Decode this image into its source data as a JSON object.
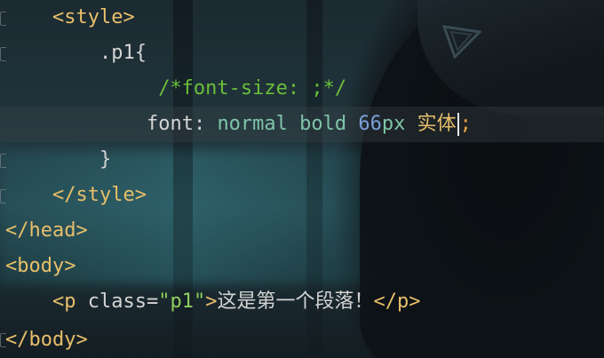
{
  "editor": {
    "lines": [
      {
        "indent": "    ",
        "tag_open": "<style>"
      },
      {
        "indent": "        ",
        "selector": ".p1",
        "brace": "{"
      },
      {
        "indent": "             ",
        "comment": "/*font-size: ;*/"
      },
      {
        "indent": "            ",
        "property": "font",
        "colon": ": ",
        "value1": "normal bold ",
        "number": "66",
        "unit": "px ",
        "font_name": "实体",
        "semicolon": ";"
      },
      {
        "indent": "        ",
        "brace": "}"
      },
      {
        "indent": "    ",
        "tag_close": "</style>"
      },
      {
        "indent": "",
        "tag_close": "</head>"
      },
      {
        "indent": "",
        "tag_open": "<body>"
      },
      {
        "indent": "    ",
        "p_open": "<p ",
        "attr_name": "class",
        "eq": "=",
        "attr_value": "\"p1\"",
        "gt": ">",
        "content": "这是第一个段落！",
        "p_close": "</p>"
      },
      {
        "indent": "",
        "tag_close": "</body>"
      }
    ]
  }
}
